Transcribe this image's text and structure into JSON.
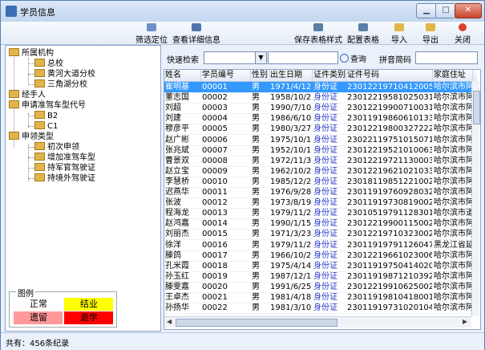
{
  "window": {
    "title": "学员信息",
    "min": "▁",
    "max": "□",
    "close": "✕"
  },
  "toolbar": {
    "filter": "筛选定位",
    "details": "查看详细信息",
    "save_style": "保存表格样式",
    "config": "配置表格",
    "import": "导入",
    "export": "导出",
    "close": "关闭"
  },
  "tree": {
    "org": "所属机构",
    "zong": "总校",
    "huangheroad": "黄河大道分校",
    "sanjiao": "三角湖分校",
    "handler": "经手人",
    "apply_code": "申请准驾车型代号",
    "b2": "B2",
    "c1": "C1",
    "apply_type": "申领类型",
    "first": "初次申领",
    "add": "增加准驾车型",
    "military": "持军官驾驶证",
    "foreign": "持境外驾驶证"
  },
  "legend": {
    "title": "图例",
    "normal": "正常",
    "done": "结业",
    "retained": "遗留",
    "dropped": "退学",
    "colors": {
      "normal": "#ffffff",
      "done": "#ffff00",
      "retained": "#ff9999",
      "dropped": "#ff0000"
    }
  },
  "search": {
    "label": "快速检索",
    "query": "查询",
    "pinyin": "拼音简码",
    "combo_arrow": "▼"
  },
  "grid": {
    "headers": [
      "姓名",
      "学员编号",
      "性别",
      "出生日期",
      "证件类别",
      "证件号码",
      "家庭住址"
    ],
    "rows": [
      [
        "崔明基",
        "00001",
        "男",
        "1971/4/12",
        "身份证",
        "230122197104120057",
        "哈尔滨市阿城"
      ],
      [
        "董志国",
        "00002",
        "男",
        "1958/10/25",
        "身份证",
        "230122195810250319",
        "哈尔滨市阿城"
      ],
      [
        "刘超",
        "00003",
        "男",
        "1990/7/10",
        "身份证",
        "23012219900710031X",
        "哈尔滨市阿城"
      ],
      [
        "刘建",
        "00004",
        "男",
        "1986/6/10",
        "身份证",
        "230119198606101338",
        "哈尔滨市阿城"
      ],
      [
        "穆彦平",
        "00005",
        "男",
        "1980/3/27",
        "身份证",
        "230122198003272226",
        "哈尔滨市阿城"
      ],
      [
        "赵广彬",
        "00006",
        "男",
        "1975/10/15",
        "身份证",
        "230221197510150711",
        "哈尔滨市阿城"
      ],
      [
        "张兆斌",
        "00007",
        "男",
        "1952/10/10",
        "身份证",
        "230122195210100632",
        "哈尔滨市阿城"
      ],
      [
        "曹景双",
        "00008",
        "男",
        "1972/11/30",
        "身份证",
        "230122197211300037",
        "哈尔滨市阿城"
      ],
      [
        "赵立宝",
        "00009",
        "男",
        "1962/10/21",
        "身份证",
        "230122196210210334",
        "哈尔滨市阿城"
      ],
      [
        "李慧桥",
        "00010",
        "男",
        "1985/12/21",
        "身份证",
        "230181198512210021",
        "哈尔滨市阿城"
      ],
      [
        "迟燕华",
        "00011",
        "男",
        "1976/9/28",
        "身份证",
        "230119197609280322",
        "哈尔滨市阿城"
      ],
      [
        "张波",
        "00012",
        "男",
        "1973/8/19",
        "身份证",
        "230119197308190024",
        "哈尔滨市阿城"
      ],
      [
        "程海龙",
        "00013",
        "男",
        "1979/11/28",
        "身份证",
        "230105197911283016",
        "哈尔滨市道外"
      ],
      [
        "赵鸿嘉",
        "00014",
        "男",
        "1990/1/15",
        "身份证",
        "230122199001150025",
        "哈尔滨市阿城"
      ],
      [
        "刘丽杰",
        "00015",
        "男",
        "1971/3/23",
        "身份证",
        "23012219710323002?",
        "哈尔滨市阿城"
      ],
      [
        "徐洋",
        "00016",
        "男",
        "1979/11/26",
        "身份证",
        "23011919791126047X",
        "黑龙江省延寿"
      ],
      [
        "滕鸽",
        "00017",
        "男",
        "1966/10/23",
        "身份证",
        "23012219661023006X",
        "哈尔滨市阿城"
      ],
      [
        "孔米霞",
        "00018",
        "男",
        "1975/4/14",
        "身份证",
        "230119197504140207",
        "哈尔滨市阿城"
      ],
      [
        "孙玉红",
        "00019",
        "男",
        "1987/12/10",
        "身份证",
        "230119198712103927",
        "哈尔滨市阿城"
      ],
      [
        "滕雯嘉",
        "00020",
        "男",
        "1991/6/25",
        "身份证",
        "230122199106250022",
        "哈尔滨市阿城"
      ],
      [
        "王卓杰",
        "00021",
        "男",
        "1981/4/18",
        "身份证",
        "230119198104180013",
        "哈尔滨市阿城"
      ],
      [
        "孙扬华",
        "00022",
        "男",
        "1981/3/10",
        "身份证",
        "230119197310201044",
        "哈尔滨市阿城"
      ]
    ]
  },
  "status": {
    "text": "共有：456条纪录"
  }
}
